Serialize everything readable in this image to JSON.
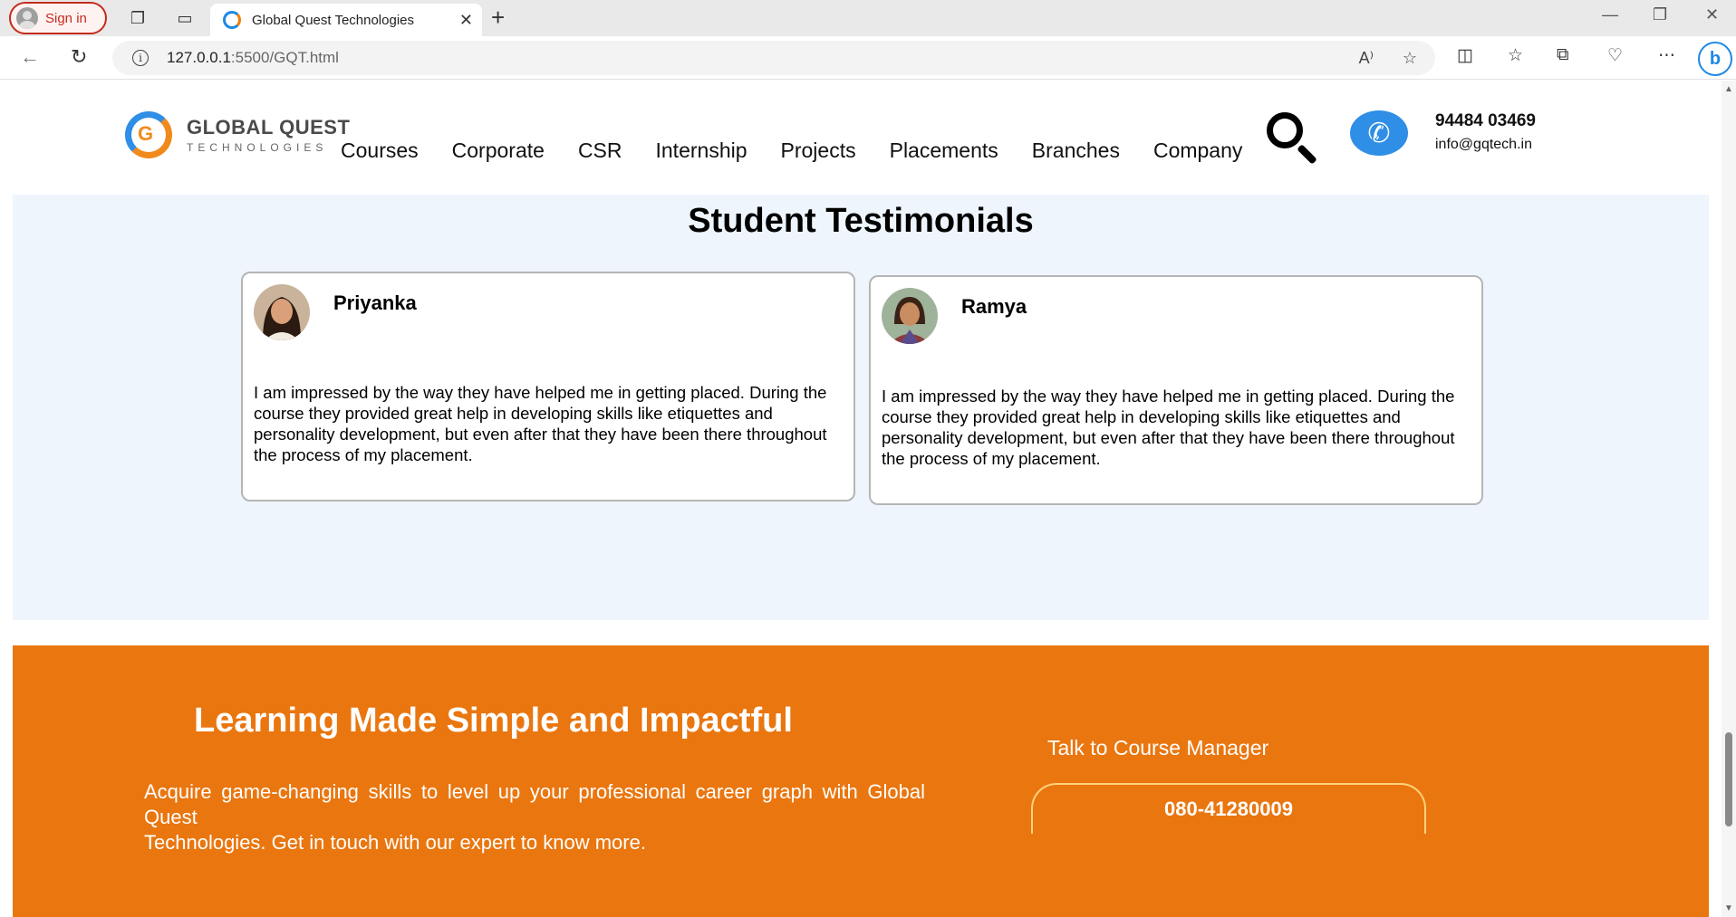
{
  "browser": {
    "signin_label": "Sign in",
    "tab_title": "Global Quest Technologies",
    "url_host": "127.0.0.1",
    "url_path": ":5500/GQT.html"
  },
  "header": {
    "logo_line1": "GLOBAL QUEST",
    "logo_line2": "TECHNOLOGIES",
    "nav": [
      "Courses",
      "Corporate",
      "CSR",
      "Internship",
      "Projects",
      "Placements",
      "Branches",
      "Company"
    ],
    "phone": "94484 03469",
    "email": "info@gqtech.in"
  },
  "testimonials": {
    "title": "Student Testimonials",
    "cards": [
      {
        "name": "Priyanka",
        "quote": "I am impressed by the way they have helped me in getting placed. During the course they provided great help in developing skills like etiquettes and personality development, but even after that they have been there throughout the process of my placement."
      },
      {
        "name": "Ramya",
        "quote": "I am impressed by the way they have helped me in getting placed. During the course they provided great help in developing skills like etiquettes and personality development, but even after that they have been there throughout the process of my placement."
      }
    ]
  },
  "cta": {
    "title": "Learning Made Simple and Impactful",
    "text_line1": "Acquire game-changing skills to level up your professional career graph with Global Quest",
    "text_line2": "Technologies. Get in touch with our expert to know more.",
    "talk_label": "Talk to Course Manager",
    "call_number": "080-41280009"
  },
  "colors": {
    "accent_orange": "#ea760f",
    "accent_blue": "#2f8ee6",
    "section_bg": "#eef5fd"
  }
}
